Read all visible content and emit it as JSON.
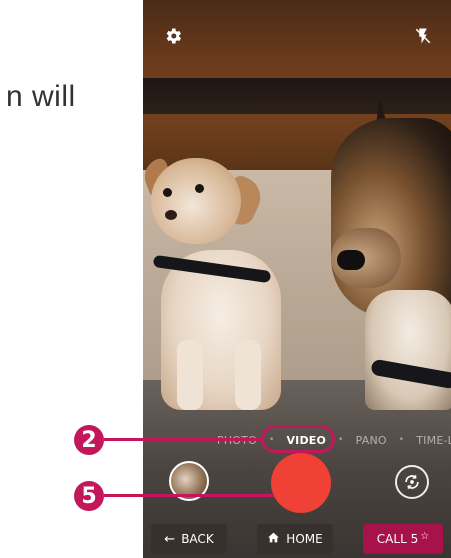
{
  "instruction_fragment": "n will",
  "camera": {
    "modes": [
      "PHOTO",
      "VIDEO",
      "PANO",
      "TIME-LAP"
    ],
    "active_mode": "VIDEO",
    "icons": {
      "settings": "gear-icon",
      "flash": "flash-off-icon",
      "switch_camera": "camera-switch-icon"
    },
    "shutter_color": "#ef4135"
  },
  "navbar": {
    "back_label": "BACK",
    "home_label": "HOME",
    "call_label": "CALL 5",
    "call_star": "☆"
  },
  "callouts": {
    "mode_badge": "2",
    "shutter_badge": "5",
    "accent_color": "#c2185b"
  }
}
